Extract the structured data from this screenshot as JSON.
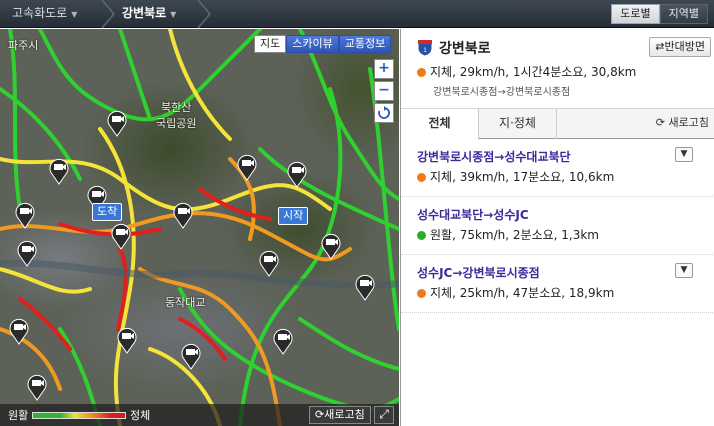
{
  "breadcrumb": {
    "level1": "고속화도로",
    "level2": "강변북로"
  },
  "view_toggle": {
    "road": "도로별",
    "region": "지역별"
  },
  "map": {
    "tabs": {
      "map": "지도",
      "skyview": "스카이뷰",
      "traffic": "교통정보"
    },
    "zoom_in": "+",
    "zoom_out": "−",
    "labels": {
      "paju": "파주시",
      "park": "북한산\n국립공원",
      "dongjak": "동작대교"
    },
    "flags": {
      "start": "시작",
      "end": "도착"
    },
    "legend": {
      "smooth": "원활",
      "congested": "정체",
      "refresh": "새로고침"
    },
    "colors": {
      "green": "#2fd02f",
      "yellow": "#f4e43a",
      "orange": "#f19a22",
      "red": "#e0201e"
    }
  },
  "route": {
    "title": "강변북로",
    "reverse_button": "반대방면",
    "status": "지체, 29km/h, 1시간4분소요, 30,8km",
    "status_color": "orange",
    "subtitle": "강변북로시종점→강변북로시종점"
  },
  "tabs": {
    "all": "전체",
    "congestion": "지·정체",
    "refresh": "새로고침"
  },
  "segments": [
    {
      "title": "강변북로시종점→성수대교북단",
      "status": "지체, 39km/h, 17분소요, 10,6km",
      "color": "orange",
      "expandable": true
    },
    {
      "title": "성수대교북단→성수JC",
      "status": "원활, 75km/h, 2분소요, 1,3km",
      "color": "green",
      "expandable": false
    },
    {
      "title": "성수JC→강변북로시종점",
      "status": "지체, 25km/h, 47분소요, 18,9km",
      "color": "orange",
      "expandable": true
    }
  ]
}
